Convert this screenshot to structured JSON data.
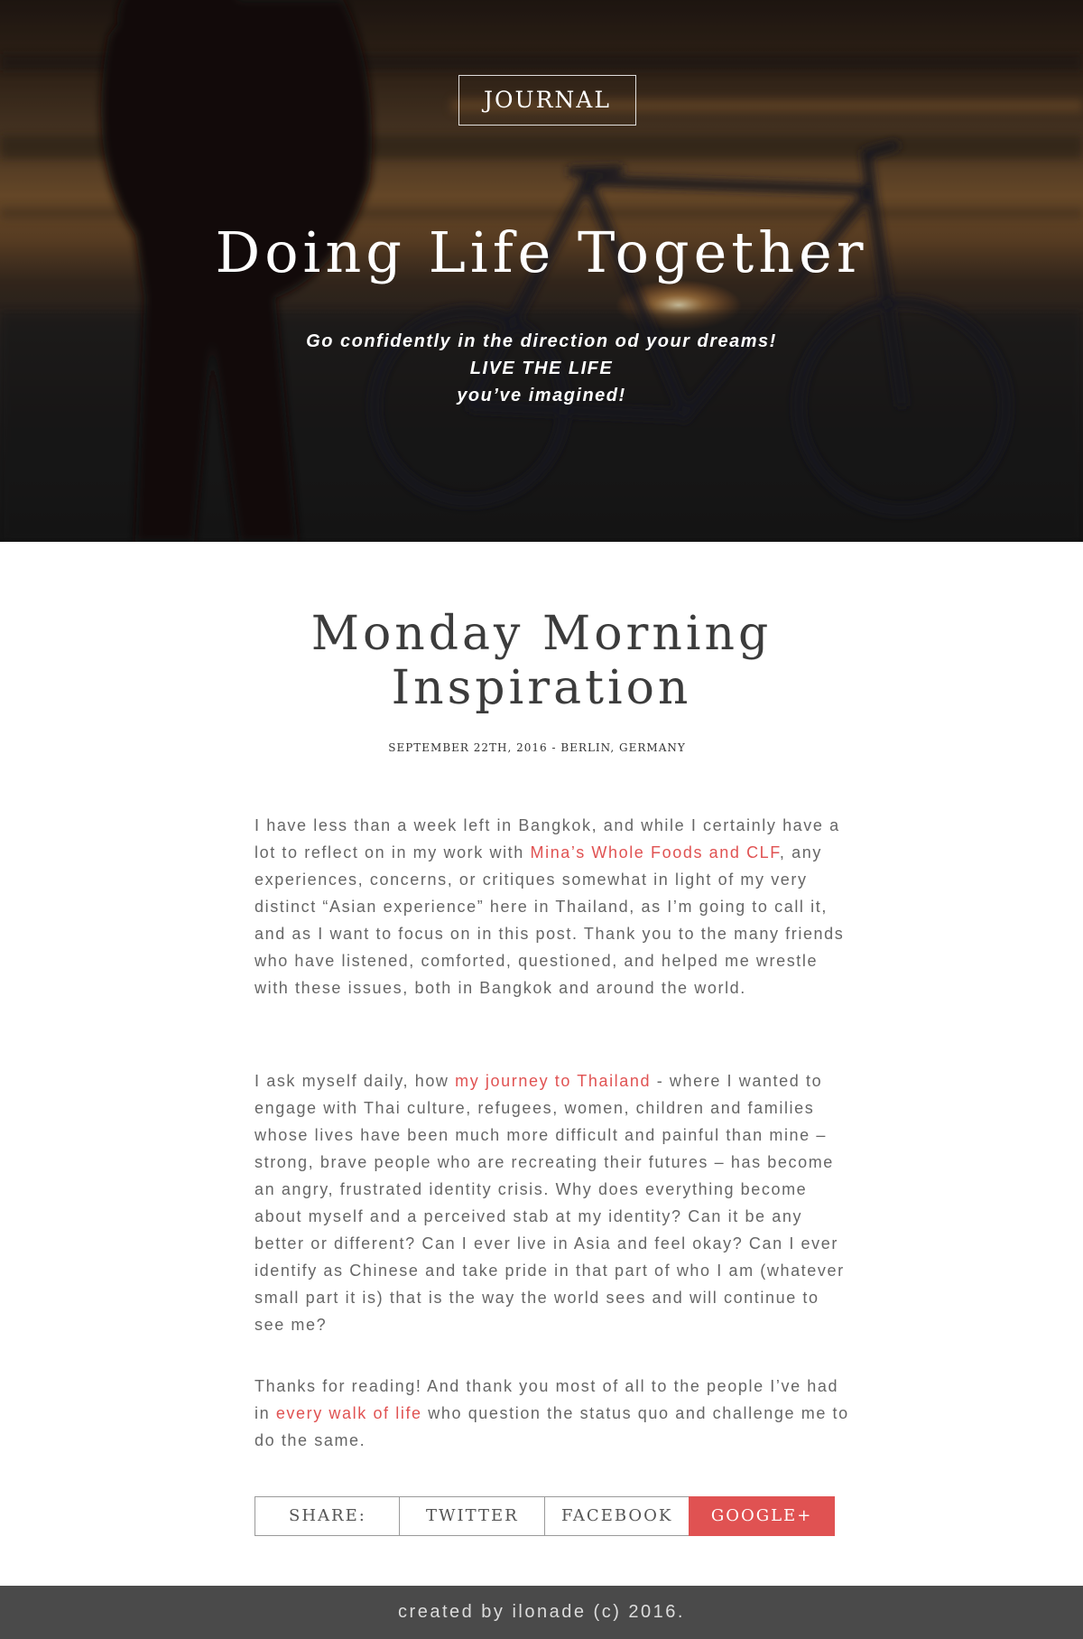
{
  "hero": {
    "badge": "JOURNAL",
    "title": "Doing Life Together",
    "tagline_line1": "Go confidently in the direction od your dreams!",
    "tagline_line2": "LIVE THE LIFE",
    "tagline_line3": "you’ve imagined!"
  },
  "article": {
    "title": "Monday Morning Inspiration",
    "meta": "September 22th, 2016 - Berlin, Germany",
    "paragraph1": {
      "before": "I have less than a week left in Bangkok, and while I certainly have a lot to reflect on in my work with ",
      "link": "Mina’s Whole Foods and CLF",
      "after": ", any experiences, concerns, or critiques somewhat in light of my very distinct “Asian experience” here in Thailand, as I’m going to call it, and as I want to focus on in this post. Thank you to the many friends who have listened, comforted, questioned, and helped me wrestle with these issues, both in Bangkok and around the world."
    },
    "paragraph2": {
      "before": "I ask myself daily, how ",
      "link": "my journey to Thailand",
      "after": " - where I wanted to engage with Thai culture, refugees, women, children and families whose lives have been much more difficult and painful than mine – strong, brave people who are recreating their futures – has become an angry, frustrated identity crisis. Why does everything become about myself and a perceived stab at my identity? Can it be any better or different? Can I ever live in Asia and feel okay? Can I ever identify as Chinese and take pride in that part of who I am (whatever small part it is) that is the way the world sees and will continue to see me?"
    },
    "paragraph3": {
      "before": "Thanks for reading! And thank you most of all to the people I’ve had in ",
      "link": "every walk of life",
      "after": " who question the status quo and challenge me to do the same."
    }
  },
  "share": {
    "label": "SHARE:",
    "twitter": "TWITTER",
    "facebook": "FACEBOOK",
    "google": "GOOGLE+"
  },
  "footer": {
    "text": "created by ilonade (c) 2016."
  },
  "colors": {
    "accent": "#e05252",
    "text": "#666666",
    "footer_bg": "#4a4a4a"
  }
}
